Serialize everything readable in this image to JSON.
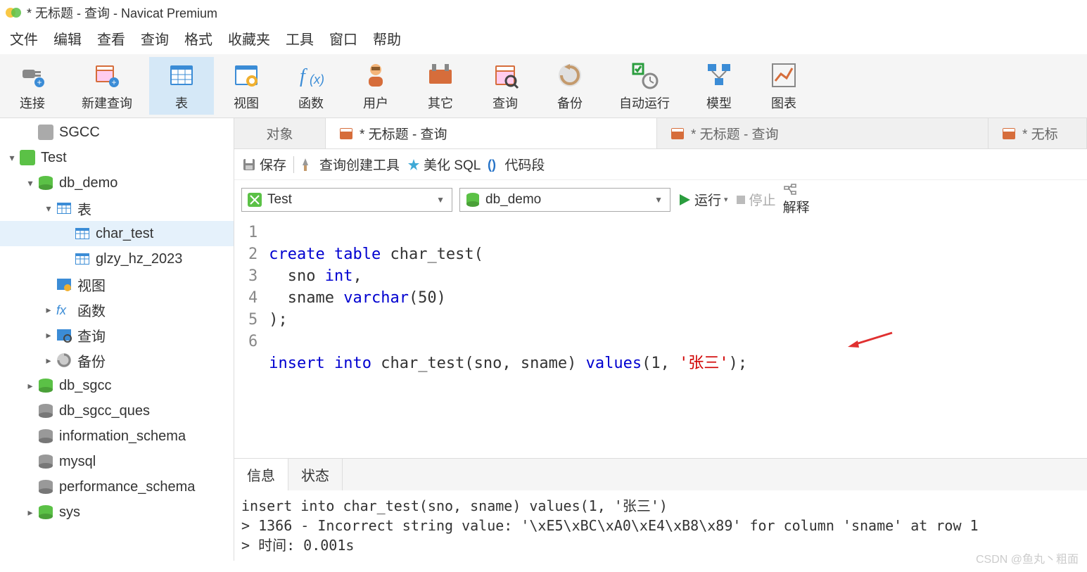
{
  "title_bar": {
    "text": "* 无标题 - 查询 - Navicat Premium"
  },
  "menu": [
    "文件",
    "编辑",
    "查看",
    "查询",
    "格式",
    "收藏夹",
    "工具",
    "窗口",
    "帮助"
  ],
  "toolbar": [
    {
      "label": "连接",
      "icon": "plug-icon"
    },
    {
      "label": "新建查询",
      "icon": "new-query-icon"
    },
    {
      "label": "表",
      "icon": "table-icon",
      "selected": true
    },
    {
      "label": "视图",
      "icon": "view-icon"
    },
    {
      "label": "函数",
      "icon": "fx-icon"
    },
    {
      "label": "用户",
      "icon": "user-icon"
    },
    {
      "label": "其它",
      "icon": "other-icon"
    },
    {
      "label": "查询",
      "icon": "query-icon"
    },
    {
      "label": "备份",
      "icon": "backup-icon"
    },
    {
      "label": "自动运行",
      "icon": "autorun-icon"
    },
    {
      "label": "模型",
      "icon": "model-icon"
    },
    {
      "label": "图表",
      "icon": "chart-icon"
    }
  ],
  "sidebar": {
    "nodes": [
      {
        "indent": 1,
        "toggle": "",
        "icon": "conn-grey-icon",
        "label": "SGCC"
      },
      {
        "indent": 0,
        "toggle": "▾",
        "icon": "conn-green-icon",
        "label": "Test"
      },
      {
        "indent": 1,
        "toggle": "▾",
        "icon": "db-green-icon",
        "label": "db_demo"
      },
      {
        "indent": 2,
        "toggle": "▾",
        "icon": "table-node-icon",
        "label": "表"
      },
      {
        "indent": 3,
        "toggle": "",
        "icon": "table-item-icon",
        "label": "char_test",
        "selected": true
      },
      {
        "indent": 3,
        "toggle": "",
        "icon": "table-item-icon",
        "label": "glzy_hz_2023"
      },
      {
        "indent": 2,
        "toggle": "",
        "icon": "view-node-icon",
        "label": "视图"
      },
      {
        "indent": 2,
        "toggle": "▸",
        "icon": "fx-node-icon",
        "label": "函数"
      },
      {
        "indent": 2,
        "toggle": "▸",
        "icon": "query-node-icon",
        "label": "查询"
      },
      {
        "indent": 2,
        "toggle": "▸",
        "icon": "backup-node-icon",
        "label": "备份"
      },
      {
        "indent": 1,
        "toggle": "▸",
        "icon": "db-green-icon",
        "label": "db_sgcc"
      },
      {
        "indent": 1,
        "toggle": "",
        "icon": "db-grey-icon",
        "label": "db_sgcc_ques"
      },
      {
        "indent": 1,
        "toggle": "",
        "icon": "db-grey-icon",
        "label": "information_schema"
      },
      {
        "indent": 1,
        "toggle": "",
        "icon": "db-grey-icon",
        "label": "mysql"
      },
      {
        "indent": 1,
        "toggle": "",
        "icon": "db-grey-icon",
        "label": "performance_schema"
      },
      {
        "indent": 1,
        "toggle": "▸",
        "icon": "db-green-icon",
        "label": "sys"
      }
    ]
  },
  "tabs": [
    {
      "label": "对象",
      "icon": "none",
      "active": false
    },
    {
      "label": "* 无标题 - 查询",
      "icon": "query-tab-icon",
      "active": true
    },
    {
      "label": "* 无标题 - 查询",
      "icon": "query-tab-icon",
      "active": false
    },
    {
      "label": "* 无标",
      "icon": "query-tab-icon",
      "active": false
    }
  ],
  "sub_toolbar": {
    "save": "保存",
    "builder": "查询创建工具",
    "beautify": "美化 SQL",
    "snippet": "代码段"
  },
  "selectors": {
    "conn": "Test",
    "db": "db_demo",
    "run": "运行",
    "stop": "停止",
    "explain": "解释"
  },
  "editor": {
    "line_count": 6,
    "lines": {
      "l1_kw1": "create",
      "l1_kw2": "table",
      "l1_txt": " char_test(",
      "l2_pre": "  sno ",
      "l2_kw": "int",
      "l2_post": ",",
      "l3_pre": "  sname ",
      "l3_kw": "varchar",
      "l3_post": "(50)",
      "l4_txt": ");",
      "l6_kw1": "insert",
      "l6_kw2": "into",
      "l6_mid": " char_test(sno, sname) ",
      "l6_kw3": "values",
      "l6_open": "(1, ",
      "l6_str": "'张三'",
      "l6_close": ");"
    }
  },
  "result": {
    "tabs": [
      "信息",
      "状态"
    ],
    "active_tab": 0,
    "body": "insert into char_test(sno, sname) values(1, '张三')\n> 1366 - Incorrect string value: '\\xE5\\xBC\\xA0\\xE4\\xB8\\x89' for column 'sname' at row 1\n> 时间: 0.001s"
  },
  "watermark": "CSDN @鱼丸丶粗面"
}
